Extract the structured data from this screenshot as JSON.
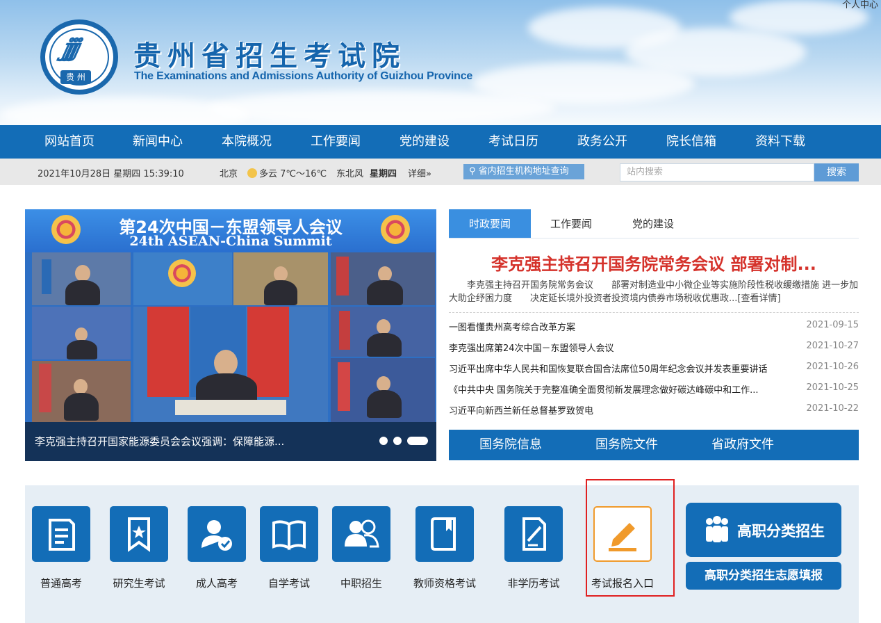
{
  "header": {
    "personal_center": "个人中心",
    "emblem_label": "贵 州",
    "title_cn": "贵州省招生考试院",
    "title_en": "The Examinations and Admissions Authority of Guizhou Province"
  },
  "nav": {
    "items": [
      {
        "label": "网站首页"
      },
      {
        "label": "新闻中心"
      },
      {
        "label": "本院概况"
      },
      {
        "label": "工作要闻"
      },
      {
        "label": "党的建设"
      },
      {
        "label": "考试日历"
      },
      {
        "label": "政务公开"
      },
      {
        "label": "院长信箱"
      },
      {
        "label": "资料下载"
      }
    ]
  },
  "infobar": {
    "datetime": "2021年10月28日 星期四 15:39:10",
    "city": "北京",
    "weather": "多云 7℃～16℃",
    "wind": "东北风",
    "weekday": "星期四",
    "detail": "详细»",
    "address_query": "省内招生机构地址查询",
    "search_placeholder": "站内搜索",
    "search_button": "搜索"
  },
  "banner": {
    "title_cn": "第24次中国－东盟领导人会议",
    "title_en": "24th ASEAN-China Summit",
    "caption": "李克强主持召开国家能源委员会会议强调：保障能源..."
  },
  "news": {
    "tabs": [
      "时政要闻",
      "工作要闻",
      "党的建设"
    ],
    "active_tab": 0,
    "headline": "李克强主持召开国务院常务会议 部署对制...",
    "summary": "李克强主持召开国务院常务会议　　部署对制造业中小微企业等实施阶段性税收缓缴措施 进一步加大助企纾困力度　　决定延长境外投资者投资境内债券市场税收优惠政...[查看详情]",
    "items": [
      {
        "title": "一图看懂贵州高考综合改革方案",
        "date": "2021-09-15"
      },
      {
        "title": "李克强出席第24次中国－东盟领导人会议",
        "date": "2021-10-27"
      },
      {
        "title": "习近平出席中华人民共和国恢复联合国合法席位50周年纪念会议并发表重要讲话",
        "date": "2021-10-26"
      },
      {
        "title": "《中共中央 国务院关于完整准确全面贯彻新发展理念做好碳达峰碳中和工作...",
        "date": "2021-10-25"
      },
      {
        "title": "习近平向新西兰新任总督基罗致贺电",
        "date": "2021-10-22"
      }
    ],
    "sub_nav": [
      "国务院信息",
      "国务院文件",
      "省政府文件"
    ]
  },
  "services": {
    "items": [
      {
        "label": "普通高考",
        "icon": "document-icon"
      },
      {
        "label": "研究生考试",
        "icon": "bookmark-star-icon"
      },
      {
        "label": "成人高考",
        "icon": "user-check-icon"
      },
      {
        "label": "自学考试",
        "icon": "open-book-icon"
      },
      {
        "label": "中职招生",
        "icon": "users-icon"
      },
      {
        "label": "教师资格考试",
        "icon": "book-icon"
      },
      {
        "label": "非学历考试",
        "icon": "edit-document-icon"
      },
      {
        "label": "考试报名入口",
        "icon": "pencil-icon"
      }
    ],
    "big_button": "高职分类招生",
    "small_button": "高职分类招生志愿填报"
  },
  "colors": {
    "primary": "#136db7",
    "accent_red": "#d5322b",
    "highlight_orange": "#f09a2b",
    "highlight_box": "#e02020"
  }
}
